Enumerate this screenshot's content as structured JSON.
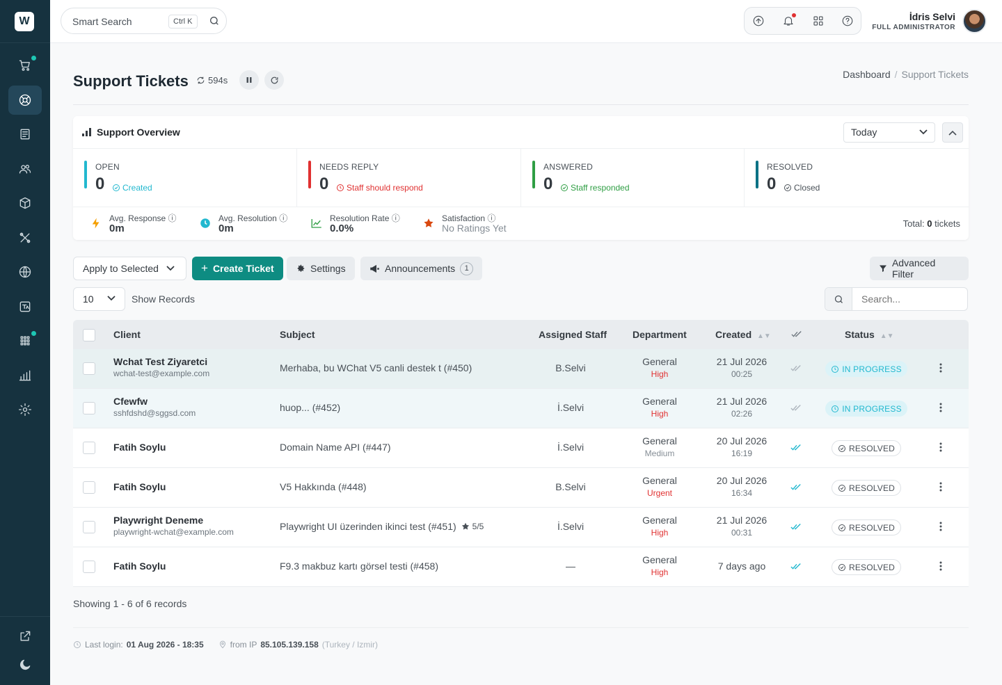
{
  "header": {
    "search_label": "Smart Search",
    "search_shortcut": "Ctrl K",
    "user_name": "İdris Selvi",
    "user_role": "FULL ADMINISTRATOR"
  },
  "page": {
    "title": "Support Tickets",
    "refresh_timer": "594s",
    "breadcrumb": [
      "Dashboard",
      "/",
      "Support Tickets"
    ]
  },
  "overview": {
    "title": "Support Overview",
    "period": "Today",
    "stats": [
      {
        "name": "OPEN",
        "value": "0",
        "sub": "Created",
        "color": "#22b8cf"
      },
      {
        "name": "NEEDS REPLY",
        "value": "0",
        "sub": "Staff should respond",
        "color": "#e03131"
      },
      {
        "name": "ANSWERED",
        "value": "0",
        "sub": "Staff responded",
        "color": "#2f9e44"
      },
      {
        "name": "RESOLVED",
        "value": "0",
        "sub": "Closed",
        "color": "#0b7285"
      }
    ],
    "metrics": [
      {
        "label": "Avg. Response",
        "value": "0m"
      },
      {
        "label": "Avg. Resolution",
        "value": "0m"
      },
      {
        "label": "Resolution Rate",
        "value": "0.0%"
      },
      {
        "label": "Satisfaction",
        "value": "No Ratings Yet"
      }
    ],
    "total_prefix": "Total:",
    "total_count": "0",
    "total_suffix": "tickets"
  },
  "toolbar": {
    "apply_label": "Apply to Selected",
    "create_label": "Create Ticket",
    "settings_label": "Settings",
    "announcements_label": "Announcements",
    "announcements_count": "1",
    "advanced_filter_label": "Advanced Filter",
    "records_value": "10",
    "show_records_label": "Show Records",
    "search_placeholder": "Search..."
  },
  "table": {
    "columns": {
      "client": "Client",
      "subject": "Subject",
      "staff": "Assigned Staff",
      "department": "Department",
      "created": "Created",
      "status": "Status"
    },
    "rows": [
      {
        "client": "Wchat Test Ziyaretci",
        "email": "wchat-test@example.com",
        "subject": "Merhaba, bu WChat V5 canli destek t (#450)",
        "rating": "",
        "staff": "B.Selvi",
        "department": "General",
        "priority": "High",
        "date": "21 Jul 2026",
        "time": "00:25",
        "status": "IN PROGRESS"
      },
      {
        "client": "Cfewfw",
        "email": "sshfdshd@sggsd.com",
        "subject": "huop... (#452)",
        "rating": "",
        "staff": "İ.Selvi",
        "department": "General",
        "priority": "High",
        "date": "21 Jul 2026",
        "time": "02:26",
        "status": "IN PROGRESS"
      },
      {
        "client": "Fatih Soylu",
        "email": "",
        "subject": "Domain Name API (#447)",
        "rating": "",
        "staff": "İ.Selvi",
        "department": "General",
        "priority": "Medium",
        "date": "20 Jul 2026",
        "time": "16:19",
        "status": "RESOLVED"
      },
      {
        "client": "Fatih Soylu",
        "email": "",
        "subject": "V5 Hakkında (#448)",
        "rating": "",
        "staff": "B.Selvi",
        "department": "General",
        "priority": "Urgent",
        "date": "20 Jul 2026",
        "time": "16:34",
        "status": "RESOLVED"
      },
      {
        "client": "Playwright Deneme",
        "email": "playwright-wchat@example.com",
        "subject": "Playwright UI üzerinden ikinci test (#451)",
        "rating": "5/5",
        "staff": "İ.Selvi",
        "department": "General",
        "priority": "High",
        "date": "21 Jul 2026",
        "time": "00:31",
        "status": "RESOLVED"
      },
      {
        "client": "Fatih Soylu",
        "email": "",
        "subject": "F9.3 makbuz kartı görsel testi (#458)",
        "rating": "",
        "staff": "—",
        "department": "General",
        "priority": "High",
        "date": "7 days ago",
        "time": "",
        "status": "RESOLVED"
      }
    ]
  },
  "footer": {
    "showing": "Showing 1 - 6 of 6 records",
    "last_login_label": "Last login:",
    "last_login_value": "01 Aug 2026 - 18:35",
    "ip_label": "from IP",
    "ip_value": "85.105.139.158",
    "ip_location": "(Turkey / Izmir)"
  },
  "colors": {
    "sidebar": "#16323f",
    "primary": "#0e8c82",
    "priority_high": "#e03131",
    "priority_medium": "#868e96",
    "in_progress": "#22b8cf"
  }
}
